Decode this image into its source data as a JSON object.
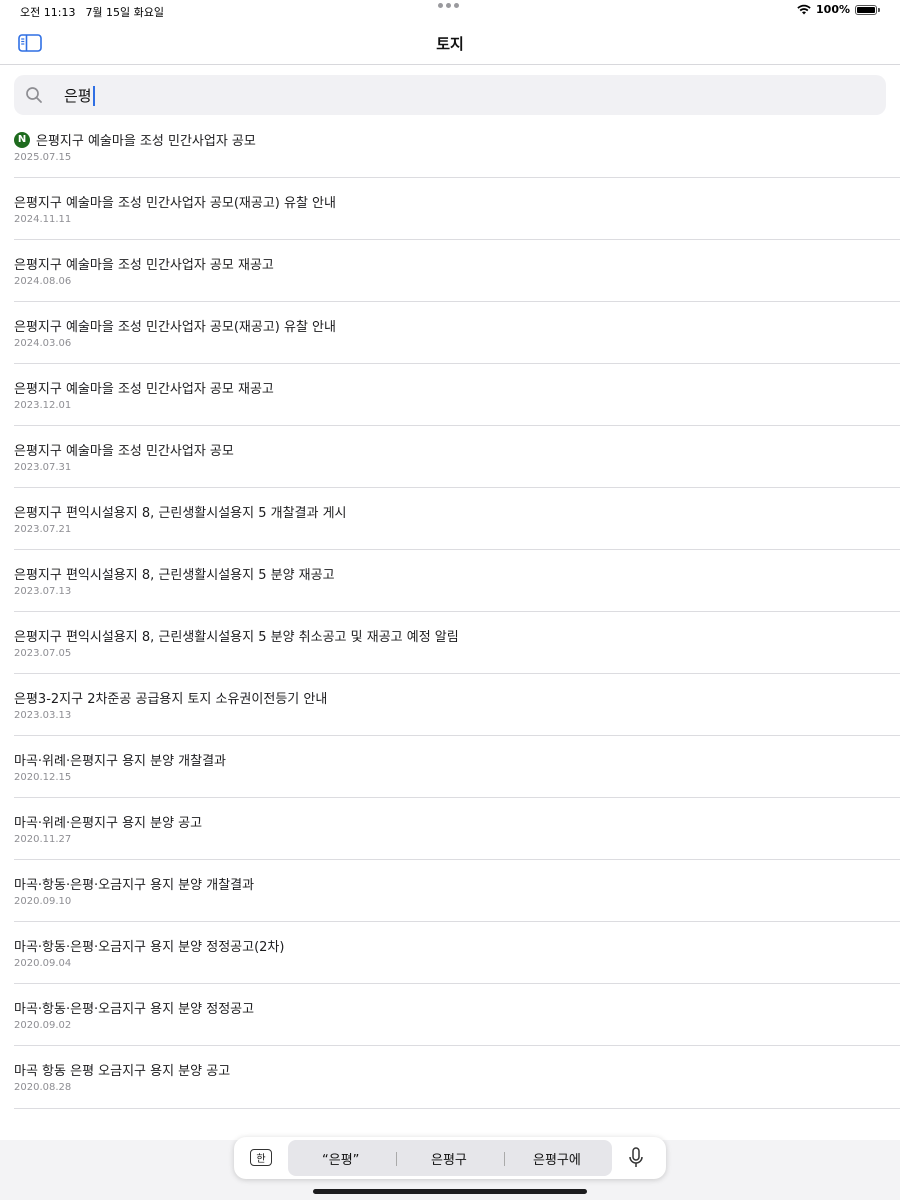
{
  "status": {
    "time": "오전 11:13",
    "date": "7월 15일 화요일",
    "battery": "100%"
  },
  "nav": {
    "title": "토지"
  },
  "search": {
    "query": "은평"
  },
  "items": [
    {
      "title": "은평지구 예술마을 조성 민간사업자 공모",
      "date": "2025.07.15",
      "badge": "N"
    },
    {
      "title": "은평지구 예술마을 조성 민간사업자 공모(재공고) 유찰 안내",
      "date": "2024.11.11"
    },
    {
      "title": "은평지구 예술마을 조성 민간사업자 공모 재공고",
      "date": "2024.08.06"
    },
    {
      "title": "은평지구 예술마을 조성 민간사업자 공모(재공고) 유찰 안내",
      "date": "2024.03.06"
    },
    {
      "title": "은평지구 예술마을 조성 민간사업자 공모 재공고",
      "date": "2023.12.01"
    },
    {
      "title": "은평지구 예술마을 조성 민간사업자 공모",
      "date": "2023.07.31"
    },
    {
      "title": "은평지구 편익시설용지 8, 근린생활시설용지 5 개찰결과 게시",
      "date": "2023.07.21"
    },
    {
      "title": "은평지구 편익시설용지 8, 근린생활시설용지 5 분양 재공고",
      "date": "2023.07.13"
    },
    {
      "title": "은평지구 편익시설용지 8, 근린생활시설용지 5 분양 취소공고 및 재공고 예정 알림",
      "date": "2023.07.05"
    },
    {
      "title": "은평3-2지구 2차준공 공급용지 토지 소유권이전등기 안내",
      "date": "2023.03.13"
    },
    {
      "title": "마곡·위례·은평지구 용지 분양 개찰결과",
      "date": "2020.12.15"
    },
    {
      "title": "마곡·위례·은평지구 용지 분양 공고",
      "date": "2020.11.27"
    },
    {
      "title": "마곡·항동·은평·오금지구 용지 분양 개찰결과",
      "date": "2020.09.10"
    },
    {
      "title": "마곡·항동·은평·오금지구 용지 분양 정정공고(2차)",
      "date": "2020.09.04"
    },
    {
      "title": "마곡·항동·은평·오금지구 용지 분양 정정공고",
      "date": "2020.09.02"
    },
    {
      "title": "마곡 항동 은평 오금지구 용지 분양 공고",
      "date": "2020.08.28"
    }
  ],
  "keyboard": {
    "lang_key": "한",
    "suggestions": [
      "“은평”",
      "은평구",
      "은평구에"
    ]
  },
  "colors": {
    "new_badge": "#1e6b1e",
    "caret": "#2f6fe4",
    "icon_blue": "#2f6fe4"
  },
  "icons": {
    "sidebar_toggle": "sidebar-toggle-icon",
    "search": "search-icon",
    "wifi": "wifi-icon",
    "battery": "battery-icon",
    "mic": "mic-icon"
  }
}
